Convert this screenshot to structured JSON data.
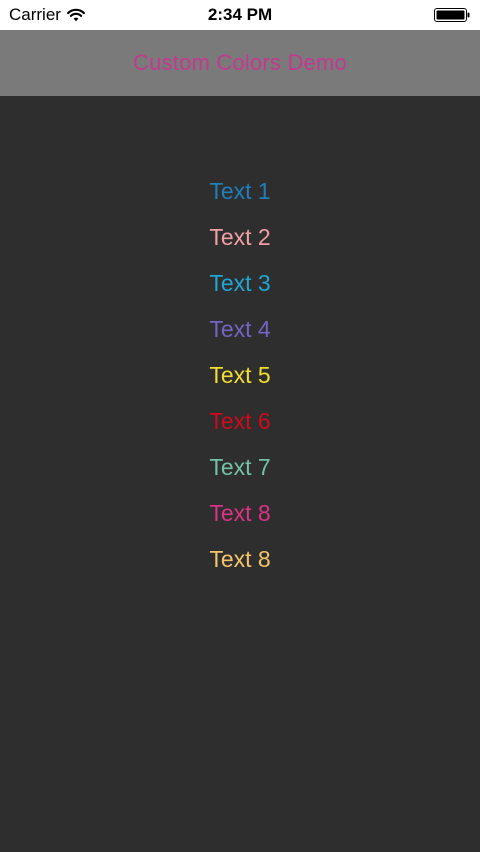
{
  "status_bar": {
    "carrier": "Carrier",
    "time": "2:34 PM",
    "wifi_icon": "wifi-icon",
    "battery_icon": "battery-icon"
  },
  "nav_bar": {
    "title": "Custom Colors Demo",
    "title_color": "#c4388f",
    "background": "#7a7a7a"
  },
  "content": {
    "background": "#2e2e2e",
    "items": [
      {
        "label": "Text 1",
        "color": "#1f7fb8"
      },
      {
        "label": "Text 2",
        "color": "#f0a0a4"
      },
      {
        "label": "Text 3",
        "color": "#1ea6d4"
      },
      {
        "label": "Text 4",
        "color": "#7563c4"
      },
      {
        "label": "Text 5",
        "color": "#f3dd2e"
      },
      {
        "label": "Text 6",
        "color": "#cf0a1c"
      },
      {
        "label": "Text 7",
        "color": "#72c1a4"
      },
      {
        "label": "Text 8",
        "color": "#da3284"
      },
      {
        "label": "Text 8",
        "color": "#f5c46a"
      }
    ]
  }
}
